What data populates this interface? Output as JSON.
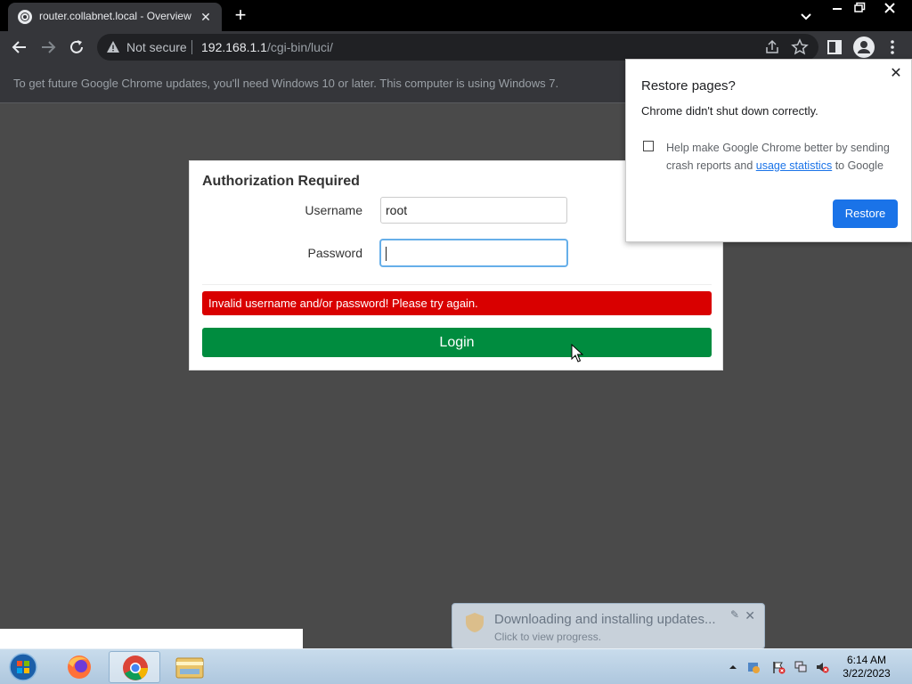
{
  "browser": {
    "tab_title": "router.collabnet.local - Overview",
    "new_tab_symbol": "+",
    "close_symbol": "✕",
    "security_label": "Not secure",
    "url_host": "192.168.1.1",
    "url_path": "/cgi-bin/luci/",
    "infobar_text": "To get future Google Chrome updates, you'll need Windows 10 or later. This computer is using Windows 7."
  },
  "login": {
    "heading": "Authorization Required",
    "username_label": "Username",
    "username_value": "root",
    "password_label": "Password",
    "password_value": "",
    "error_message": "Invalid username and/or password! Please try again.",
    "login_button": "Login"
  },
  "restore_popup": {
    "title": "Restore pages?",
    "message": "Chrome didn't shut down correctly.",
    "checkbox_text_before": "Help make Google Chrome better by sending crash reports and ",
    "checkbox_link": "usage statistics",
    "checkbox_text_after": " to Google",
    "checkbox_checked": false,
    "restore_button": "Restore"
  },
  "update_balloon": {
    "title": "Downloading and installing updates...",
    "subtitle": "Click to view progress."
  },
  "taskbar": {
    "time": "6:14 AM",
    "date": "3/22/2023",
    "apps": [
      "start-orb",
      "firefox",
      "chrome",
      "file-explorer"
    ]
  },
  "colors": {
    "page_bg": "#4a4a4a",
    "error": "#d90000",
    "login_button": "#008c3f",
    "restore_button": "#1a73e8",
    "link": "#1a73e8"
  }
}
